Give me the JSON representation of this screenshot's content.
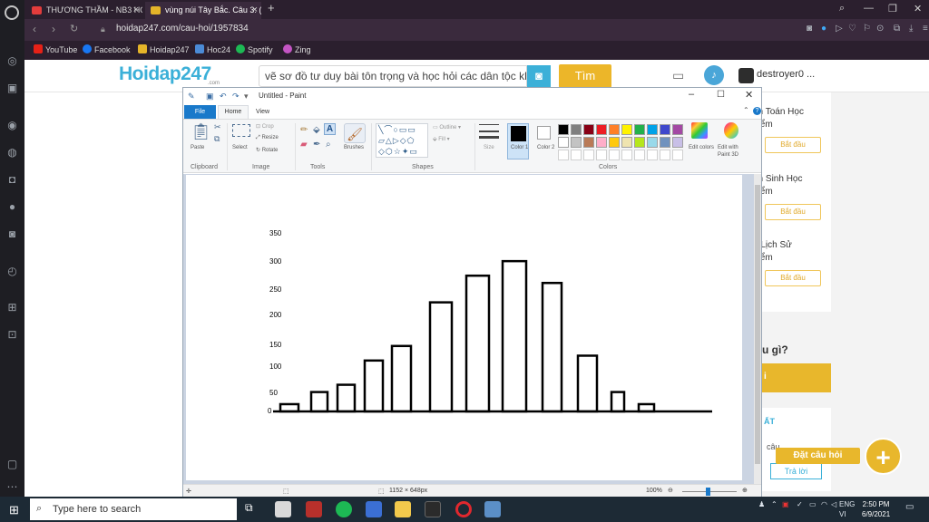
{
  "browser": {
    "tabs": [
      {
        "label": "THƯƠNG THẦM - NB3 HO",
        "favicon_color": "#e33c3c"
      },
      {
        "label": "vùng núi Tây Bắc. Câu 3: (3",
        "favicon_color": "#e4b429",
        "active": true
      }
    ],
    "new_tab_label": "+",
    "url": "hoidap247.com/cau-hoi/1957834",
    "bookmarks": [
      {
        "label": "YouTube",
        "color": "#e62117"
      },
      {
        "label": "Facebook",
        "color": "#1877f2"
      },
      {
        "label": "Hoidap247",
        "color": "#e4b429"
      },
      {
        "label": "Hoc24",
        "color": "#4b8bd6"
      },
      {
        "label": "Spotify",
        "color": "#1db954"
      },
      {
        "label": "Zing",
        "color": "#c455c4"
      }
    ]
  },
  "site": {
    "logo_text": "Hoidap247",
    "logo_sub": ".com",
    "search_text": "vẽ sơ đồ tư duy bài tôn trọng và học hỏi các dân tộc kh",
    "find_button": "Tìm",
    "username": "destroyer0 ...",
    "right_panel": {
      "cards": [
        {
          "title_1": "ôn Toán Học",
          "title_2": "điểm",
          "button": "Bắt đầu"
        },
        {
          "title_1": "ôn Sinh Học",
          "title_2": "điểm",
          "button": "Bắt đầu"
        },
        {
          "title_1": "n Lịch Sử",
          "title_2": "điểm",
          "button": "Bắt đầu"
        }
      ],
      "question_label": "u gì?",
      "yellow_label": "i",
      "box_title": "ẤT",
      "small_text": "câu...",
      "answer_button": "Trả lời"
    },
    "ask_label": "Đặt câu hỏi",
    "ask_plus": "+"
  },
  "paint": {
    "title": "Untitled - Paint",
    "tabs": {
      "file": "File",
      "home": "Home",
      "view": "View"
    },
    "groups": {
      "clipboard": "Clipboard",
      "image": "Image",
      "tools": "Tools",
      "shapes": "Shapes",
      "colors": "Colors"
    },
    "buttons": {
      "paste": "Paste",
      "select": "Select",
      "crop": "Crop",
      "resize": "Resize",
      "rotate": "Rotate",
      "brushes": "Brushes",
      "outline": "Outline",
      "fill": "Fill",
      "size": "Size",
      "color1": "Color 1",
      "color2": "Color 2",
      "edit_colors": "Edit colors",
      "edit_paint3d": "Edit with Paint 3D"
    },
    "palette": [
      "#000000",
      "#7f7f7f",
      "#880015",
      "#ed1c24",
      "#ff7f27",
      "#fff200",
      "#22b14c",
      "#00a2e8",
      "#3f48cc",
      "#a349a4",
      "#ffffff",
      "#c3c3c3",
      "#b97a57",
      "#ffaec9",
      "#ffc90e",
      "#efe4b0",
      "#b5e61d",
      "#99d9ea",
      "#7092be",
      "#c8bfe7"
    ],
    "status": {
      "dimensions": "1152 × 648px",
      "zoom": "100%"
    },
    "drawing": {
      "y_ticks": [
        "350",
        "300",
        "250",
        "200",
        "150",
        "100",
        "50",
        "0"
      ],
      "bar_values": [
        15,
        40,
        55,
        105,
        135,
        225,
        280,
        310,
        265,
        115,
        40,
        15
      ]
    }
  },
  "taskbar": {
    "search_placeholder": "Type here to search",
    "language_top": "ENG",
    "language_bottom": "VI",
    "time": "2:50 PM",
    "date": "6/9/2021"
  }
}
